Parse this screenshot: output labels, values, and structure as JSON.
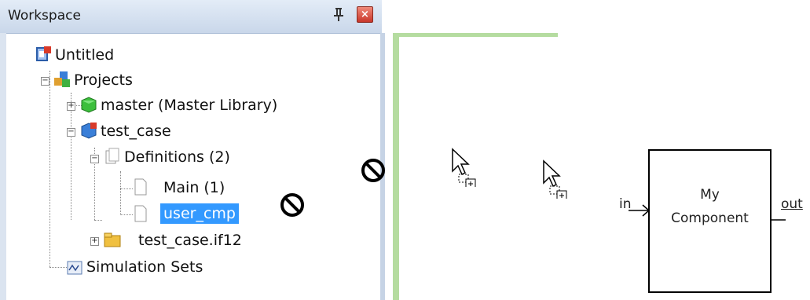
{
  "workspace": {
    "title": "Workspace",
    "pin_glyph": "⳼",
    "close_glyph": "×"
  },
  "tree": {
    "root": "Untitled",
    "projects": "Projects",
    "master": "master (Master Library)",
    "test_case": "test_case",
    "definitions": "Definitions (2)",
    "main": "Main (1)",
    "user_cmp": "user_cmp",
    "if12": "test_case.if12",
    "simulation_sets": "Simulation Sets"
  },
  "canvas": {
    "component": {
      "line1": "My",
      "line2": "Component",
      "port_in": "in",
      "port_out": "out"
    }
  },
  "colors": {
    "selection": "#3399ff",
    "header_bg": "#c9d7ea",
    "canvas_border": "#b5dca0"
  },
  "icons": [
    "workspace-file-icon",
    "projects-icon",
    "library-cube-green-icon",
    "project-cube-icon",
    "definitions-icon",
    "document-icon",
    "folder-icon",
    "simulation-sets-icon",
    "no-drop-icon",
    "drag-copy-cursor-icon",
    "pin-icon",
    "close-icon"
  ]
}
